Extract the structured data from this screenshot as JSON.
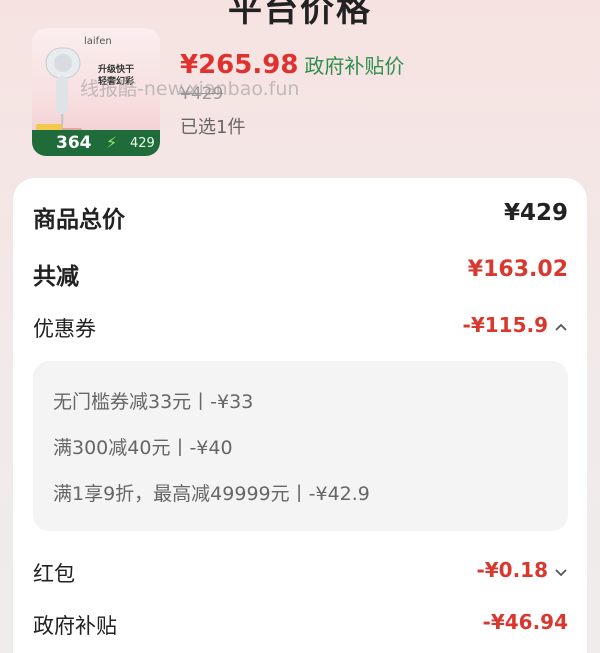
{
  "header": {
    "title_partial": "平台价格"
  },
  "product": {
    "brand": "laifen",
    "promo_line1": "升级快干",
    "promo_line2": "轻奢幻彩",
    "thumb_price_a": "364",
    "thumb_price_b": "429",
    "price_now": "¥265.98",
    "price_tag": "政府补贴价",
    "original_price": "¥429",
    "selected_count": "已选1件",
    "watermark": "线报酷-new.xianbao.fun"
  },
  "summary": {
    "total_label": "商品总价",
    "total_value": "¥429",
    "reduce_label": "共减",
    "reduce_value": "¥163.02",
    "coupon_label": "优惠券",
    "coupon_value": "-¥115.9",
    "coupons": [
      "无门槛券减33元丨-¥33",
      "满300减40元丨-¥40",
      "满1享9折，最高减49999元丨-¥42.9"
    ],
    "redpacket_label": "红包",
    "redpacket_value": "-¥0.18",
    "subsidy_label": "政府补贴",
    "subsidy_value": "-¥46.94"
  },
  "icons": {
    "coupon_toggle": "chevron-up-icon",
    "redpacket_toggle": "chevron-down-icon"
  },
  "colors": {
    "accent_red": "#e0312f",
    "subsidy_green": "#2f8f4e"
  }
}
